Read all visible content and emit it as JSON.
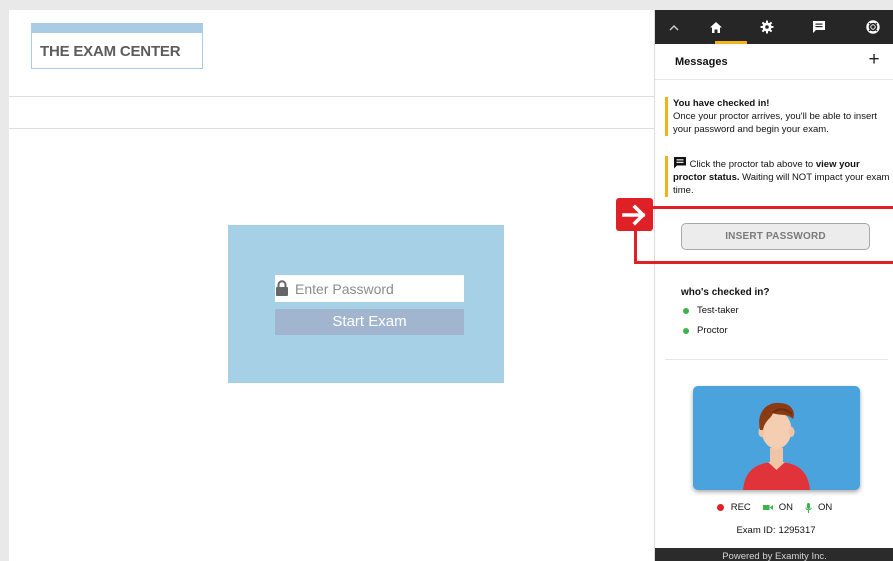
{
  "header": {
    "logo_text": "THE EXAM CENTER"
  },
  "login": {
    "password_placeholder": "Enter Password",
    "start_label": "Start Exam"
  },
  "panel": {
    "nav_icons": [
      "chevron-up-icon",
      "home-icon",
      "gear-icon",
      "chat-icon",
      "lifebuoy-icon"
    ],
    "active_tab": "home",
    "messages_title": "Messages",
    "messages": [
      {
        "title": "You have checked in!",
        "body": "Once your proctor arrives, you'll be able to insert your password and begin your exam."
      },
      {
        "text1": "Click the proctor tab above to ",
        "bold": "view your proctor status.",
        "text2": " Waiting will NOT impact your exam time."
      }
    ],
    "insert_password_label": "INSERT PASSWORD",
    "checked_in_title": "who's checked in?",
    "checked_in": [
      "Test-taker",
      "Proctor"
    ],
    "status": {
      "rec": "REC",
      "camera": "ON",
      "mic": "ON"
    },
    "exam_id_label": "Exam ID:",
    "exam_id": "1295317",
    "footer": "Powered by Examity Inc."
  },
  "colors": {
    "accent_yellow": "#f2b21c",
    "highlight_red": "#e02027",
    "login_card": "#a6d0e6",
    "start_button": "#a1b5cf",
    "nav_dark": "#262626",
    "status_green": "#3cb44b",
    "camera_bg": "#4ba3de"
  }
}
